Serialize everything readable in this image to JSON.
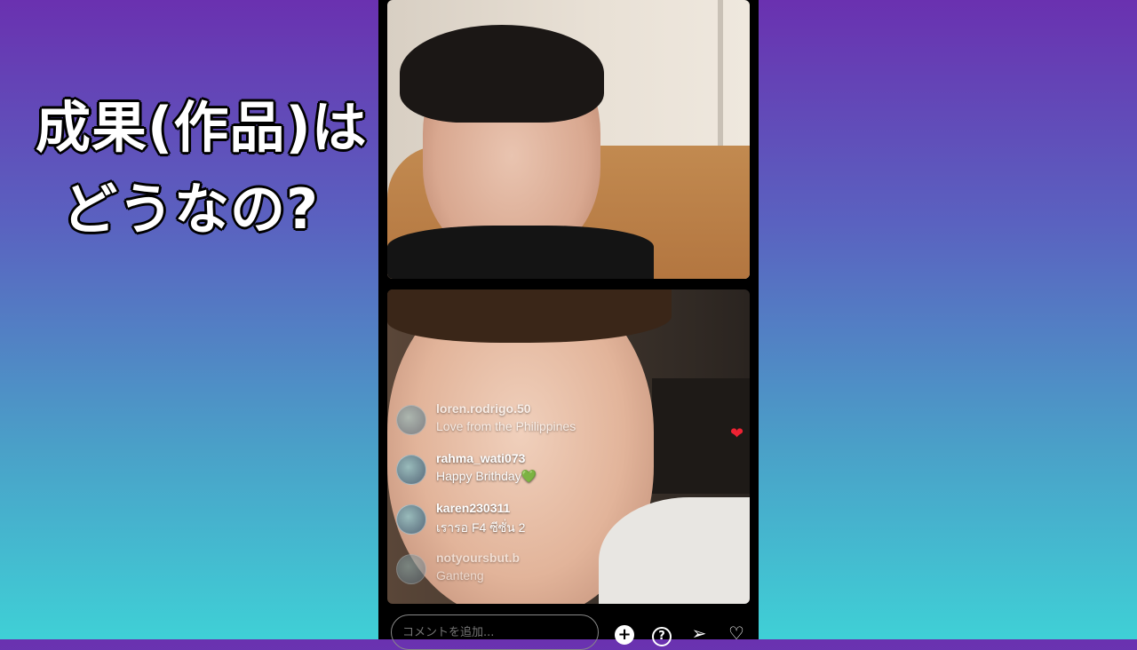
{
  "overlay_caption": {
    "line1": "成果(作品)は",
    "line2": "どうなの?"
  },
  "live": {
    "comments": [
      {
        "username": "loren.rodrigo.50",
        "text": "Love from the Philippines"
      },
      {
        "username": "rahma_wati073",
        "text": "Happy Brithday💚"
      },
      {
        "username": "karen230311",
        "text": "เรารอ F4 ซีซั่น 2"
      },
      {
        "username": "notyoursbut.b",
        "text": "Ganteng"
      }
    ],
    "floating_heart": "❤",
    "comment_input": {
      "placeholder": "コメントを追加..."
    },
    "actions": {
      "add_icon": "+",
      "help_icon": "?",
      "send_icon": "➢",
      "heart_icon": "♡"
    }
  },
  "colors": {
    "live_badge": "#e8336c",
    "background_top": "#6a31b0",
    "background_bottom": "#3fd0d6"
  }
}
